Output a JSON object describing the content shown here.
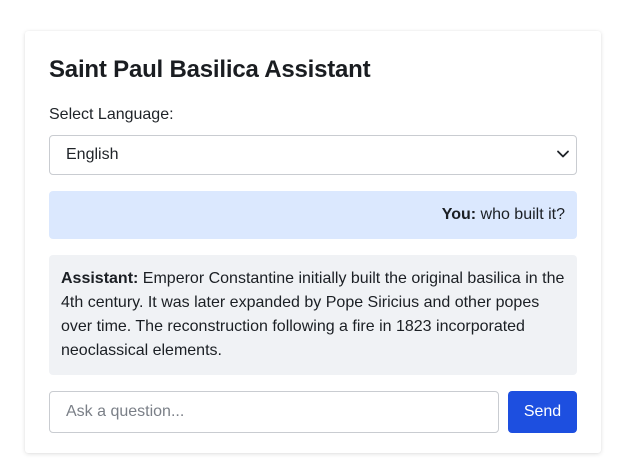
{
  "app": {
    "title": "Saint Paul Basilica Assistant"
  },
  "language": {
    "label": "Select Language:",
    "selected": "English"
  },
  "conversation": [
    {
      "speaker": "You:",
      "text": " who built it?"
    },
    {
      "speaker": "Assistant:",
      "text": " Emperor Constantine initially built the original basilica in the 4th century. It was later expanded by Pope Siricius and other popes over time. The reconstruction following a fire in 1823 incorporated neoclassical elements."
    }
  ],
  "composer": {
    "placeholder": "Ask a question...",
    "value": "",
    "send_label": "Send"
  },
  "colors": {
    "accent": "#1d4fe0",
    "user_bubble": "#dbe8fe",
    "assistant_bubble": "#f0f2f5"
  },
  "icons": {
    "select_chevron": "chevron-down-icon"
  }
}
